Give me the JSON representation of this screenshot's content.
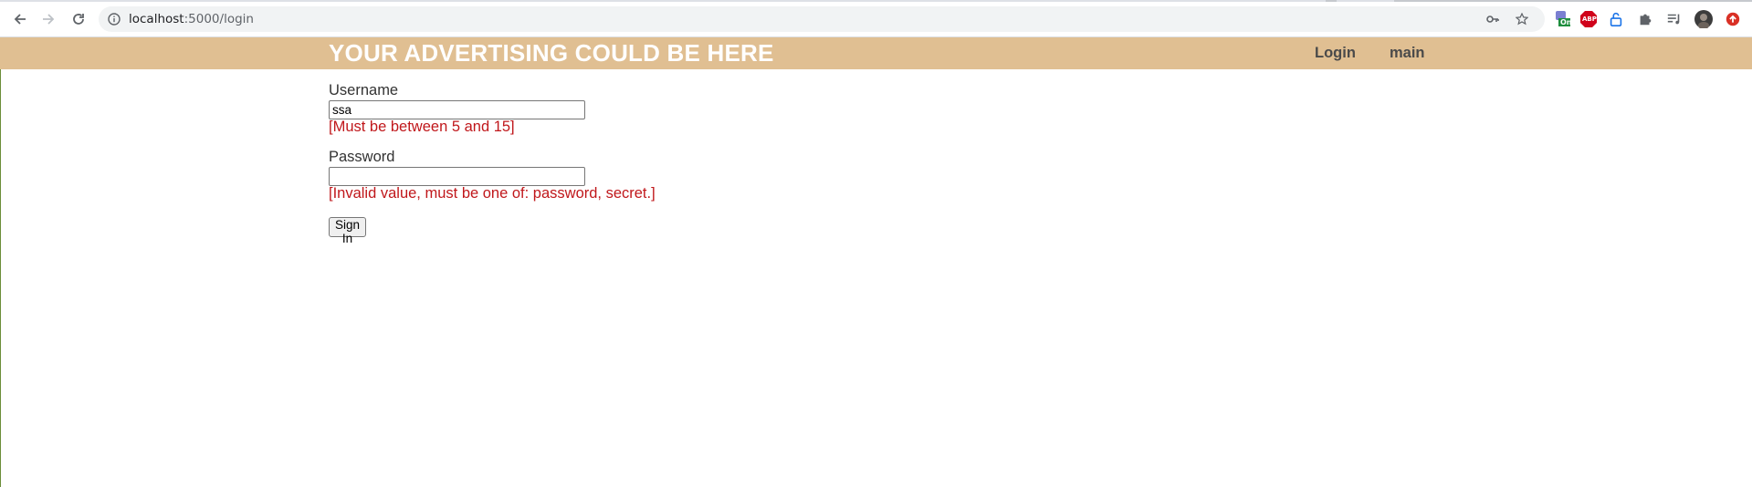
{
  "browser": {
    "url_host": "localhost",
    "url_path": ":5000/login",
    "icons": {
      "back": "back-arrow-icon",
      "forward": "forward-arrow-icon",
      "reload": "reload-icon",
      "site_info": "info-icon",
      "password_key": "key-icon",
      "bookmark": "star-icon",
      "extensions": "puzzle-icon",
      "reading_list": "reading-list-icon",
      "profile": "avatar",
      "update": "update-icon"
    },
    "ext_badge_on": "On",
    "abp_label": "ABP"
  },
  "header": {
    "title": "YOUR ADVERTISING COULD BE HERE",
    "background": "#e0bf92",
    "nav": [
      {
        "label": "Login"
      },
      {
        "label": "main"
      }
    ]
  },
  "form": {
    "username": {
      "label": "Username",
      "value": "ssa",
      "error": "[Must be between 5 and 15]"
    },
    "password": {
      "label": "Password",
      "value": "",
      "error": "[Invalid value, must be one of: password, secret.]"
    },
    "submit_label": "Sign In",
    "error_color": "#c0171b"
  }
}
